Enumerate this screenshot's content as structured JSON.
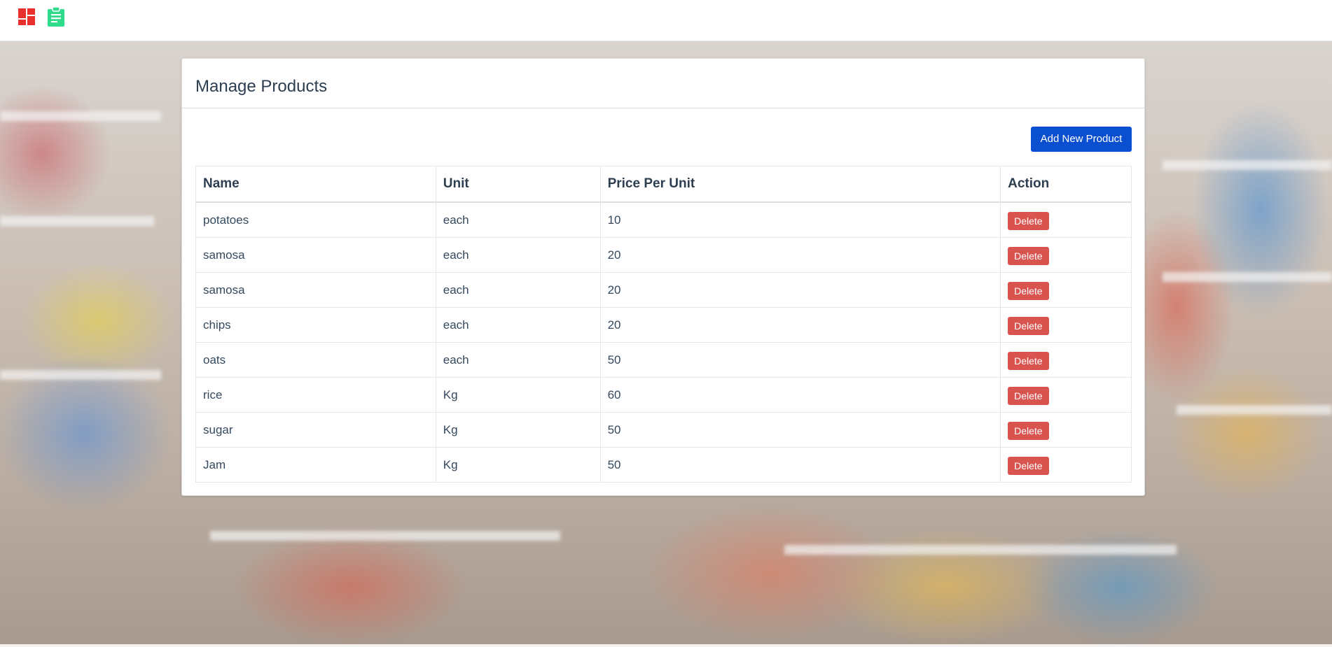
{
  "header": {
    "icons": [
      "dashboard-icon",
      "clipboard-icon"
    ],
    "colors": {
      "dashboard": "#e8312f",
      "clipboard": "#2fdc8b"
    }
  },
  "card": {
    "title": "Manage Products",
    "add_button_label": "Add New Product"
  },
  "table": {
    "columns": [
      "Name",
      "Unit",
      "Price Per Unit",
      "Action"
    ],
    "rows": [
      {
        "name": "potatoes",
        "unit": "each",
        "price": "10",
        "action": "Delete"
      },
      {
        "name": "samosa",
        "unit": "each",
        "price": "20",
        "action": "Delete"
      },
      {
        "name": "samosa",
        "unit": "each",
        "price": "20",
        "action": "Delete"
      },
      {
        "name": "chips",
        "unit": "each",
        "price": "20",
        "action": "Delete"
      },
      {
        "name": "oats",
        "unit": "each",
        "price": "50",
        "action": "Delete"
      },
      {
        "name": "rice",
        "unit": "Kg",
        "price": "60",
        "action": "Delete"
      },
      {
        "name": "sugar",
        "unit": "Kg",
        "price": "50",
        "action": "Delete"
      },
      {
        "name": "Jam",
        "unit": "Kg",
        "price": "50",
        "action": "Delete"
      }
    ]
  },
  "colors": {
    "primary_button": "#0b4fd1",
    "delete_button": "#d9534f",
    "text": "#2c3e50"
  }
}
